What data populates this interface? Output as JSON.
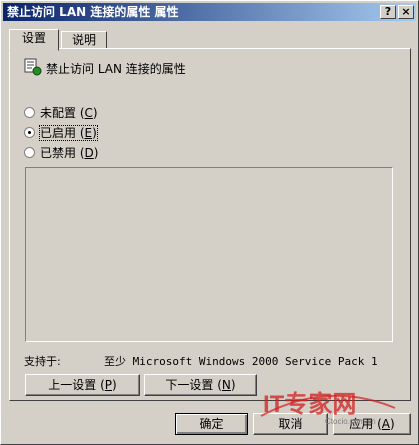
{
  "window": {
    "title": "禁止访问 LAN 连接的属性 属性"
  },
  "titlebar_buttons": {
    "help": "?",
    "close": "×"
  },
  "tabs": [
    {
      "label": "设置",
      "active": true
    },
    {
      "label": "说明",
      "active": false
    }
  ],
  "policy": {
    "name": "禁止访问 LAN 连接的属性"
  },
  "options": [
    {
      "label": "未配置",
      "key": "C",
      "checked": false
    },
    {
      "label": "已启用",
      "key": "E",
      "checked": true
    },
    {
      "label": "已禁用",
      "key": "D",
      "checked": false
    }
  ],
  "support": {
    "label": "支持于:",
    "value": "至少 Microsoft Windows 2000 Service Pack 1"
  },
  "nav": {
    "prev": "上一设置",
    "prev_key": "P",
    "next": "下一设置",
    "next_key": "N"
  },
  "buttons": {
    "ok": "确定",
    "cancel": "取消",
    "apply": "应用",
    "apply_key": "A"
  },
  "watermark": {
    "brand": "IT专家网",
    "url": "Ctocio.com.cn"
  },
  "colors": {
    "title_start": "#0a246a",
    "title_end": "#a6caf0",
    "face": "#d4d0c8",
    "watermark": "#d42020"
  }
}
